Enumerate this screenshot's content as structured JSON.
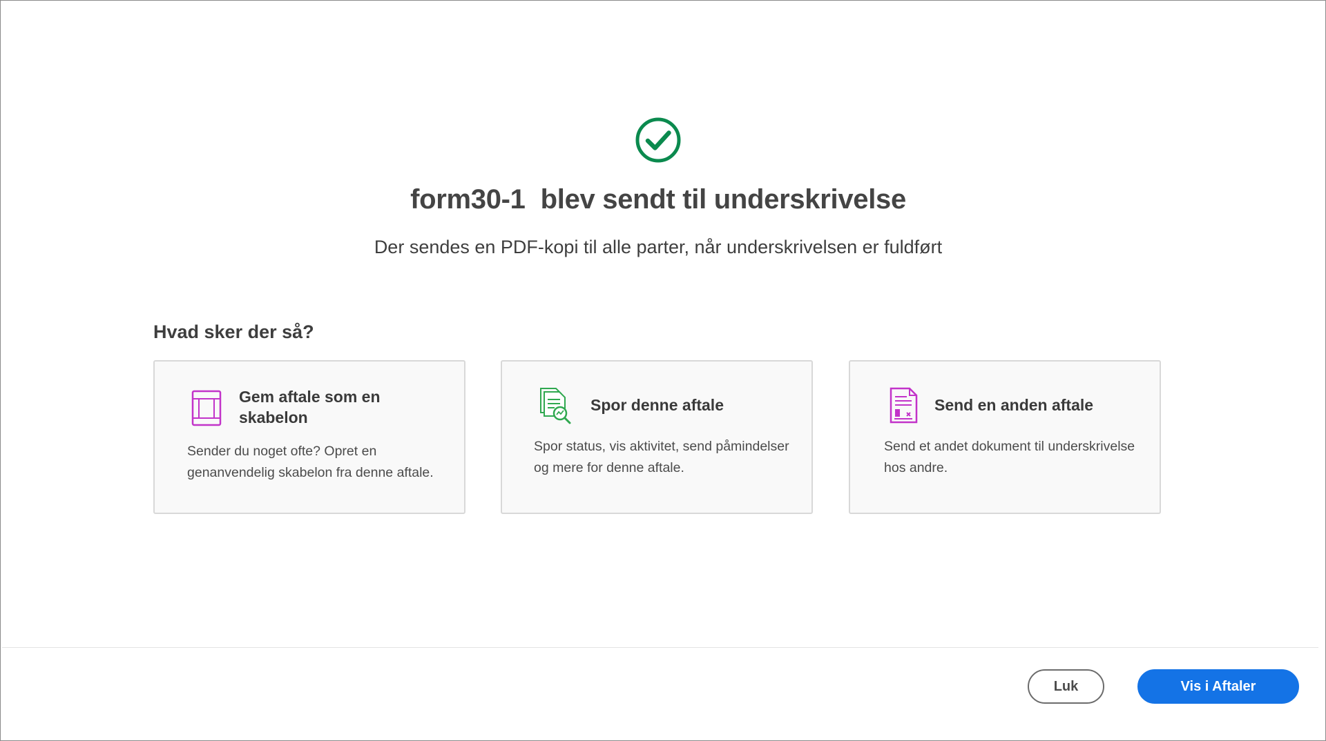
{
  "success": {
    "icon": "check-circle-icon",
    "document_name": "form30-1",
    "title_rest": "blev sendt til underskrivelse",
    "subtitle": "Der sendes en PDF-kopi til alle parter, når underskrivelsen er fuldført"
  },
  "next_steps": {
    "heading": "Hvad sker der så?",
    "cards": [
      {
        "icon": "template-document-icon",
        "title": "Gem aftale som en skabelon",
        "description": "Sender du noget ofte? Opret en genanvendelig skabelon fra denne aftale."
      },
      {
        "icon": "track-document-icon",
        "title": "Spor denne aftale",
        "description": "Spor status, vis aktivitet, send påmindelser og mere for denne aftale."
      },
      {
        "icon": "send-document-icon",
        "title": "Send en anden aftale",
        "description": "Send et andet dokument til underskrivelse hos andre."
      }
    ]
  },
  "footer": {
    "close_label": "Luk",
    "primary_label": "Vis i Aftaler"
  },
  "colors": {
    "success_green": "#0b8a4e",
    "primary_blue": "#1473e6",
    "magenta_icon": "#c233c9",
    "green_icon": "#2fa84f"
  }
}
